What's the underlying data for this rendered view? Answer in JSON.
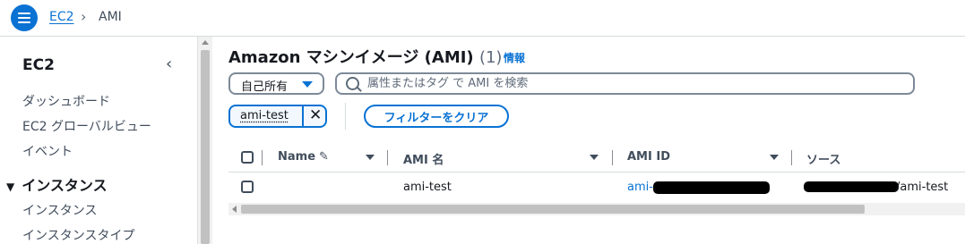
{
  "breadcrumb": {
    "link": "EC2",
    "separator": "›",
    "current": "AMI"
  },
  "sidebar": {
    "title": "EC2",
    "collapse_glyph": "‹",
    "items": [
      "ダッシュボード",
      "EC2 グローバルビュー",
      "イベント"
    ],
    "section": "インスタンス",
    "section_items": [
      "インスタンス",
      "インスタンスタイプ"
    ]
  },
  "main": {
    "title": "Amazon マシンイメージ (AMI)",
    "count": "(1)",
    "info": "情報",
    "owner_select": "自己所有",
    "search_placeholder": "属性またはタグ で AMI を検索",
    "filter_token": "ami-test",
    "clear_filters": "フィルターをクリア"
  },
  "table": {
    "columns": [
      "Name",
      "AMI 名",
      "AMI ID",
      "ソース"
    ],
    "rows": [
      {
        "name": "",
        "ami_name": "ami-test",
        "ami_id_prefix": "ami-",
        "source_suffix": "/ami-test"
      }
    ]
  },
  "colors": {
    "accent": "#0972d3",
    "text": "#16191f",
    "muted": "#414d5c"
  }
}
